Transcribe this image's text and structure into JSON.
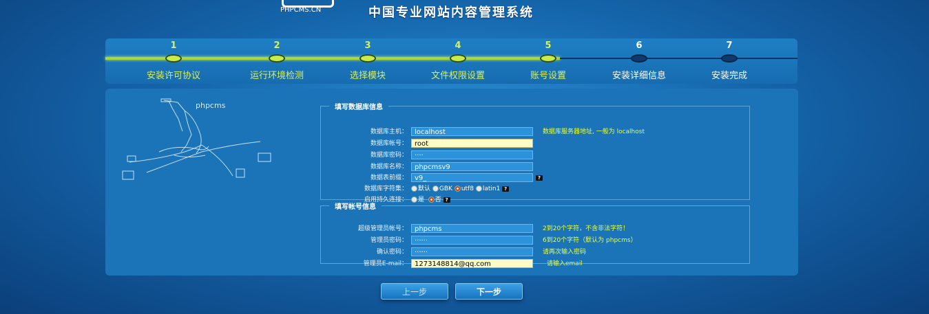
{
  "header": {
    "logo_text": "PHPCMS.CN",
    "title": "中国专业网站内容管理系统"
  },
  "steps": [
    {
      "num": "1",
      "label": "安装许可协议",
      "done": true
    },
    {
      "num": "2",
      "label": "运行环境检测",
      "done": true
    },
    {
      "num": "3",
      "label": "选择模块",
      "done": true
    },
    {
      "num": "4",
      "label": "文件权限设置",
      "done": true
    },
    {
      "num": "5",
      "label": "账号设置",
      "done": true
    },
    {
      "num": "6",
      "label": "安装详细信息",
      "done": false
    },
    {
      "num": "7",
      "label": "安装完成",
      "done": false
    }
  ],
  "illustration": {
    "label": "phpcms"
  },
  "db_section": {
    "legend": "填写数据库信息",
    "host": {
      "label": "数据库主机：",
      "value": "localhost",
      "hint": "数据库服务器地址, 一般为 localhost"
    },
    "user": {
      "label": "数据库帐号：",
      "value": "root"
    },
    "password": {
      "label": "数据库密码：",
      "value": "····"
    },
    "name": {
      "label": "数据库名称：",
      "value": "phpcmsv9"
    },
    "prefix": {
      "label": "数据表前缀：",
      "value": "v9_"
    },
    "charset": {
      "label": "数据库字符集：",
      "options": [
        "默认",
        "GBK",
        "utf8",
        "latin1"
      ],
      "selected": "utf8"
    },
    "pconnect": {
      "label": "启用持久连接：",
      "options": [
        "是",
        "否"
      ],
      "selected": "否"
    }
  },
  "admin_section": {
    "legend": "填写帐号信息",
    "username": {
      "label": "超级管理员帐号：",
      "value": "phpcms",
      "hint": "2到20个字符，不含非法字符！"
    },
    "password": {
      "label": "管理员密码：",
      "value": "······",
      "hint": "6到20个字符（默认为 phpcms）"
    },
    "confirm": {
      "label": "确认密码：",
      "value": "······",
      "hint": "请再次输入密码"
    },
    "email": {
      "label": "管理员E-mail：",
      "value": "1273148814@qq.com",
      "hint": "请输入email"
    }
  },
  "buttons": {
    "prev": "上一步",
    "next": "下一步"
  },
  "colors": {
    "accent": "#d8f05a",
    "hint": "#e8ff3a",
    "highlight_input": "#fdfbc8"
  }
}
